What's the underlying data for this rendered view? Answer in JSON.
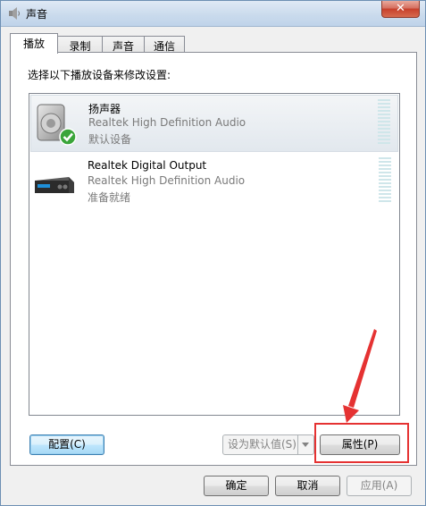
{
  "window": {
    "title": "声音",
    "close_label": "✕"
  },
  "tabs": [
    {
      "label": "播放",
      "active": true
    },
    {
      "label": "录制",
      "active": false
    },
    {
      "label": "声音",
      "active": false
    },
    {
      "label": "通信",
      "active": false
    }
  ],
  "instruction": "选择以下播放设备来修改设置:",
  "devices": [
    {
      "name": "扬声器",
      "description": "Realtek High Definition Audio",
      "status": "默认设备",
      "icon": "speaker-icon",
      "selected": true
    },
    {
      "name": "Realtek Digital Output",
      "description": "Realtek High Definition Audio",
      "status": "准备就绪",
      "icon": "digital-output-icon",
      "selected": false
    }
  ],
  "buttons": {
    "configure": "配置(C)",
    "set_default": "设为默认值(S)",
    "properties": "属性(P)",
    "ok": "确定",
    "cancel": "取消",
    "apply": "应用(A)"
  },
  "colors": {
    "annotation": "#e53232",
    "selection": "#e2e8ee",
    "accent": "#3c7fb1"
  }
}
